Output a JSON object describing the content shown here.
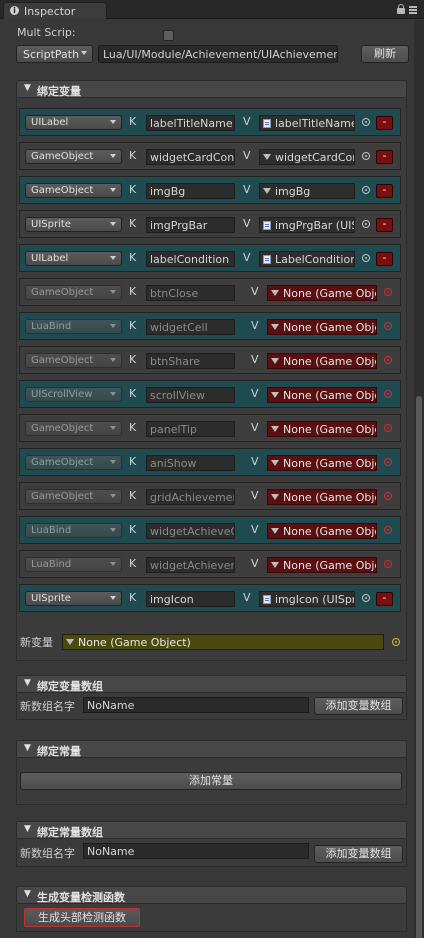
{
  "tab": {
    "title": "Inspector"
  },
  "header": {
    "mult_label": "Mult Scrip:",
    "script_dropdown": "ScriptPath",
    "path_value": "Lua/UI/Module/Achievement/UIAchievement",
    "refresh_label": "刷新"
  },
  "bind_section": {
    "title": "绑定变量",
    "k": "K",
    "v": "V",
    "rows": [
      {
        "type": "UILabel",
        "name": "labelTitleName",
        "object": "labelTitleName",
        "icon": "doc-icon",
        "state": "bound"
      },
      {
        "type": "GameObject",
        "name": "widgetCardContent",
        "object": "widgetCardContent",
        "icon": "cube-icon",
        "state": "bound"
      },
      {
        "type": "GameObject",
        "name": "imgBg",
        "object": "imgBg",
        "icon": "cube-icon",
        "state": "bound"
      },
      {
        "type": "UISprite",
        "name": "imgPrgBar",
        "object": "imgPrgBar (UISprite)",
        "icon": "doc-icon",
        "state": "bound"
      },
      {
        "type": "UILabel",
        "name": "labelCondition",
        "object": "LabelCondition",
        "icon": "doc-icon",
        "state": "bound"
      },
      {
        "type": "GameObject",
        "name": "btnClose",
        "object": "None (Game Object)",
        "icon": "cube-icon",
        "state": "missing"
      },
      {
        "type": "LuaBind",
        "name": "widgetCell",
        "object": "None (Game Object)",
        "icon": "cube-icon",
        "state": "missing"
      },
      {
        "type": "GameObject",
        "name": "btnShare",
        "object": "None (Game Object)",
        "icon": "cube-icon",
        "state": "missing"
      },
      {
        "type": "UIScrollView",
        "name": "scrollView",
        "object": "None (Game Object)",
        "icon": "cube-icon",
        "state": "missing"
      },
      {
        "type": "GameObject",
        "name": "panelTip",
        "object": "None (Game Object)",
        "icon": "cube-icon",
        "state": "missing"
      },
      {
        "type": "GameObject",
        "name": "aniShow",
        "object": "None (Game Object)",
        "icon": "cube-icon",
        "state": "missing"
      },
      {
        "type": "GameObject",
        "name": "gridAchievement",
        "object": "None (Game Object)",
        "icon": "cube-icon",
        "state": "missing"
      },
      {
        "type": "LuaBind",
        "name": "widgetAchieveCell",
        "object": "None (Game Object)",
        "icon": "cube-icon",
        "state": "missing"
      },
      {
        "type": "LuaBind",
        "name": "widgetAchievement",
        "object": "None (Game Object)",
        "icon": "cube-icon",
        "state": "missing"
      },
      {
        "type": "UISprite",
        "name": "imgIcon",
        "object": "imgIcon (UISprite)",
        "icon": "doc-icon",
        "state": "bound"
      }
    ],
    "new_var_label": "新变量",
    "new_var_value": "None (Game Object)",
    "remove_label": "-"
  },
  "bind_array_section": {
    "title": "绑定变量数组",
    "name_label": "新数组名字",
    "name_value": "NoName",
    "add_label": "添加变量数组"
  },
  "const_section": {
    "title": "绑定常量",
    "add_label": "添加常量"
  },
  "const_array_section": {
    "title": "绑定常量数组",
    "name_label": "新数组名字",
    "name_value": "NoName",
    "add_label": "添加变量数组"
  },
  "check_section": {
    "title": "生成变量检测函数",
    "button_label": "生成头部检测函数"
  },
  "colors": {
    "row_teal": "#1f4a50",
    "row_gray": "#3d3d3d",
    "missing_red": "#5a1010",
    "new_var_yellow": "#4a4a10"
  }
}
